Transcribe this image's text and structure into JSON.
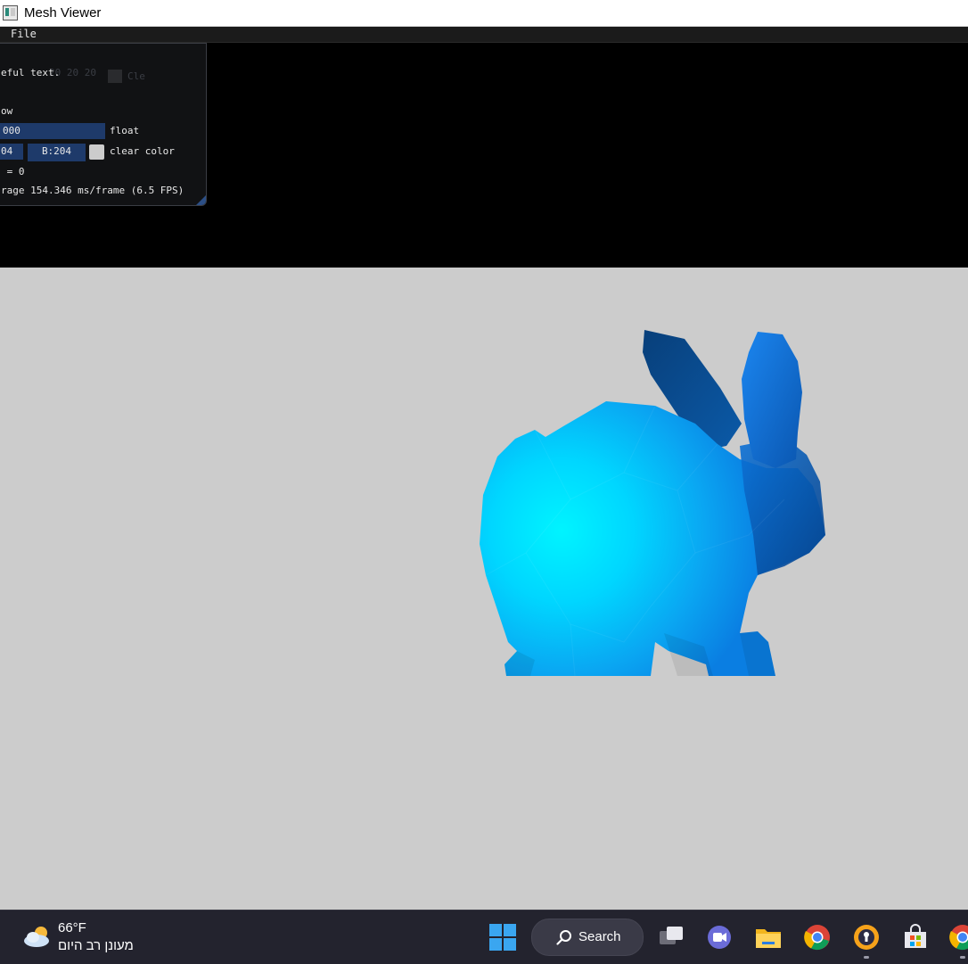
{
  "window": {
    "title": "Mesh Viewer"
  },
  "menu": {
    "file_label": "File"
  },
  "imgui": {
    "ghost_text": "20 20 20",
    "ghost_button": "Cle",
    "line_text": "eful text.",
    "line_window": "ow",
    "slider_value": "000",
    "slider_label": "float",
    "color_g": "04",
    "color_b": "B:204",
    "color_label": "clear color",
    "counter_text": " = 0",
    "fps_text": "rage 154.346 ms/frame (6.5 FPS)"
  },
  "viewport": {
    "clear_color": "#cccccc"
  },
  "taskbar": {
    "temperature": "66°F",
    "weather_condition": "מעונן רב היום",
    "search_label": "Search",
    "pinned_apps": [
      "task-view",
      "meet-chat",
      "file-explorer",
      "chrome",
      "password-manager",
      "microsoft-store",
      "chrome-profile"
    ]
  }
}
